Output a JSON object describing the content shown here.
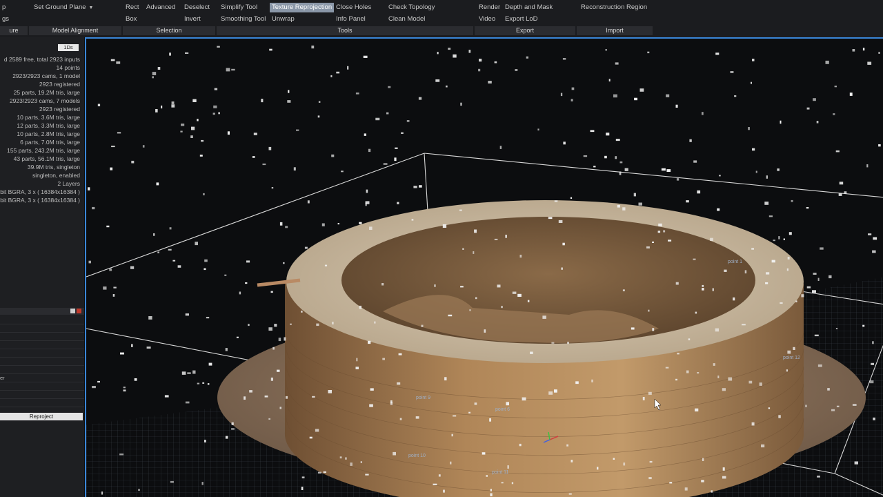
{
  "ribbon": {
    "row1": [
      {
        "label": "p"
      },
      {
        "label": "Set Ground Plane"
      },
      {
        "label": "Rect"
      },
      {
        "label": "Advanced"
      },
      {
        "label": "Deselect"
      },
      {
        "label": "Simplify Tool"
      },
      {
        "label": "Texture Reprojection"
      },
      {
        "label": "Close Holes"
      },
      {
        "label": "Check Topology"
      },
      {
        "label": "Render"
      },
      {
        "label": "Depth and Mask"
      },
      {
        "label": "Reconstruction Region"
      }
    ],
    "row2": [
      {
        "label": "gs"
      },
      {
        "label": "Box"
      },
      {
        "label": "Invert"
      },
      {
        "label": "Smoothing Tool"
      },
      {
        "label": "Unwrap"
      },
      {
        "label": "Info Panel"
      },
      {
        "label": "Clean Model"
      },
      {
        "label": "Video"
      },
      {
        "label": "Export LoD"
      }
    ],
    "groups": [
      {
        "label": "ure"
      },
      {
        "label": "Model Alignment"
      },
      {
        "label": "Selection"
      },
      {
        "label": "Tools"
      },
      {
        "label": "Export"
      },
      {
        "label": "Import"
      }
    ]
  },
  "left_panel": {
    "badge": "1Ds",
    "info_lines": [
      "d 2589 free, total 2923 inputs",
      "14 points",
      "2923/2923 cams, 1 model",
      "2923 registered",
      "25 parts, 19.2M tris, large",
      "2923/2923 cams, 7 models",
      "2923 registered",
      "10 parts, 3.6M tris, large",
      "12 parts, 3.3M tris, large",
      "10 parts, 2.8M tris, large",
      "6 parts, 7.0M tris, large",
      "155 parts, 243.2M tris, large",
      "43 parts, 56.1M tris, large",
      "39.9M tris, singleton",
      "singleton, enabled",
      "2 Layers",
      "bit BGRA, 3 x ( 16384x16384 )",
      "bit BGRA, 3 x ( 16384x16384 )"
    ],
    "field_label": "er",
    "reproject_label": "Reproject"
  },
  "viewport": {
    "point_labels": [
      "point 9",
      "point 10",
      "point 11",
      "point 12",
      "point 6",
      "point 1"
    ]
  },
  "colors": {
    "viewport_border": "#3a86d8",
    "active_tool": "#8a97a8"
  }
}
